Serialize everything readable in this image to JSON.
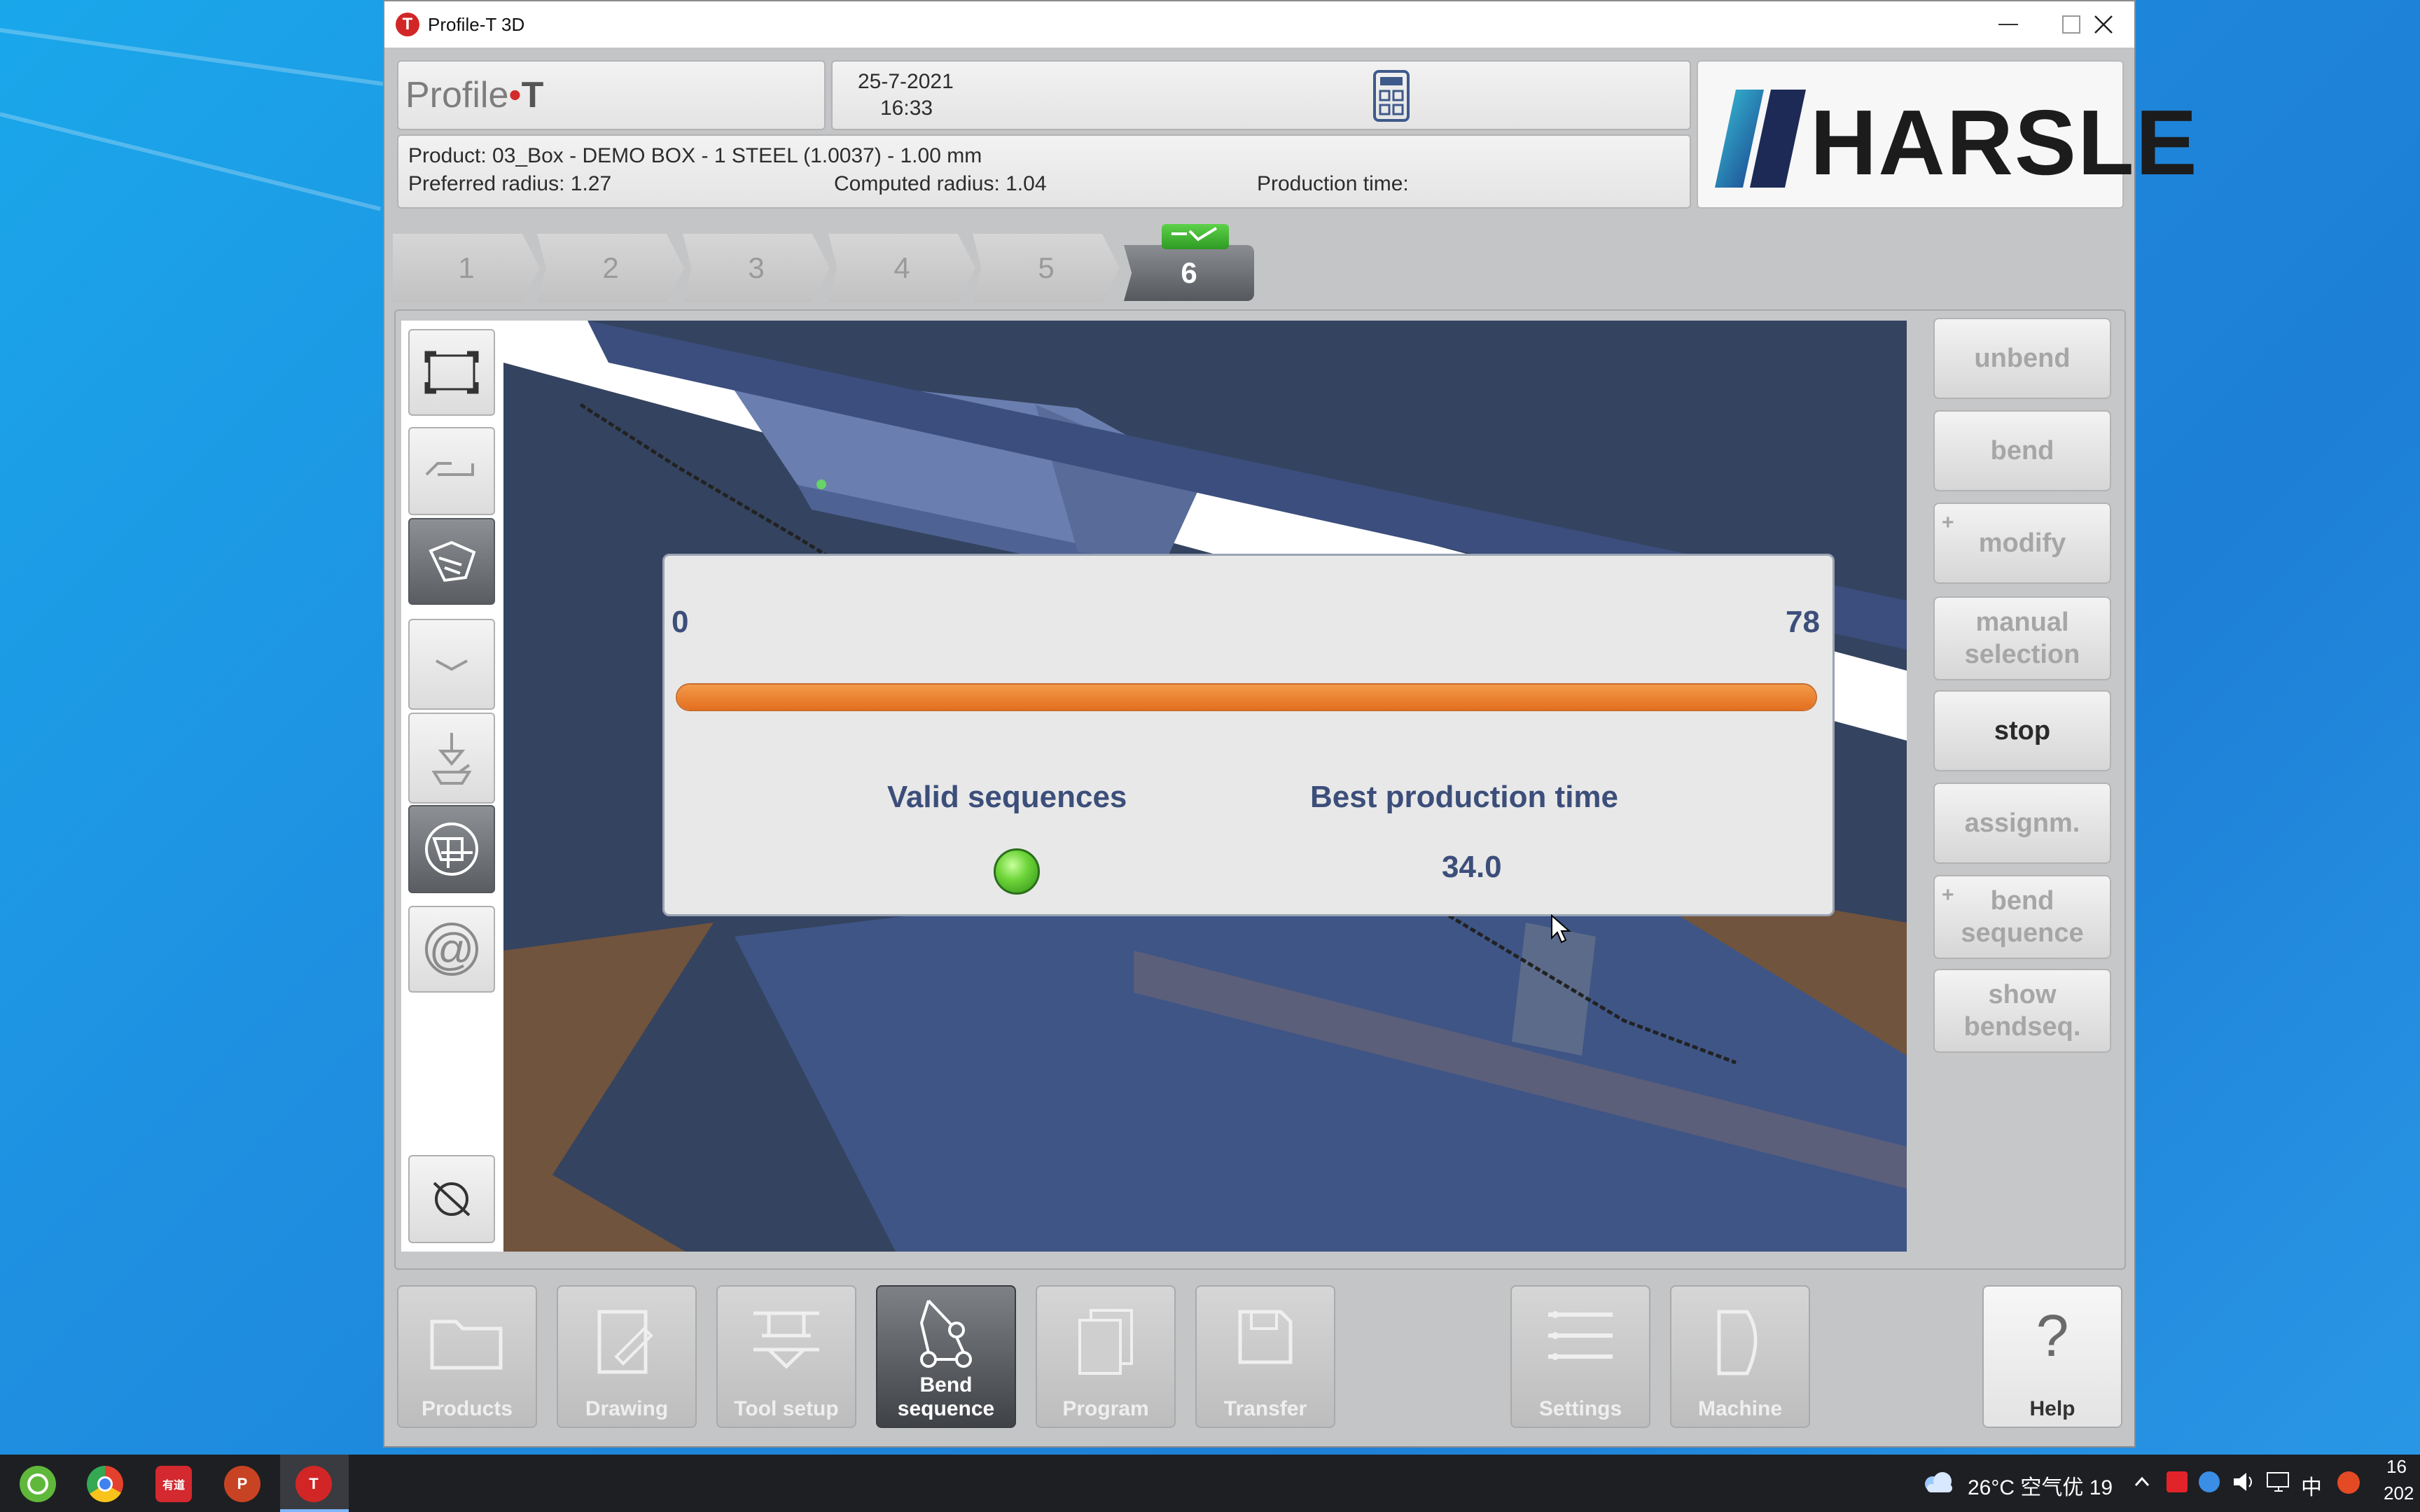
{
  "window": {
    "title": "Profile-T 3D"
  },
  "header": {
    "brand_prefix": "Profile",
    "brand_dot": "•",
    "brand_suffix": "T",
    "date": "25-7-2021",
    "time": "16:33",
    "logo_text": "HARSLE"
  },
  "product_info": {
    "product": "Product: 03_Box - DEMO BOX - 1 STEEL (1.0037) - 1.00 mm",
    "preferred_radius": "Preferred radius: 1.27",
    "computed_radius": "Computed radius: 1.04",
    "production_time": "Production time:"
  },
  "steps": [
    "1",
    "2",
    "3",
    "4",
    "5",
    "6"
  ],
  "active_step": "6",
  "dialog": {
    "min": "0",
    "max": "78",
    "progress_fraction": 1.0,
    "valid_sequences_label": "Valid sequences",
    "best_time_label": "Best production time",
    "best_time_value": "34.0",
    "status_color": "#5cc22f"
  },
  "actions": [
    {
      "label": "unbend",
      "enabled": false,
      "plus": false
    },
    {
      "label": "bend",
      "enabled": false,
      "plus": false
    },
    {
      "label": "modify",
      "enabled": false,
      "plus": true
    },
    {
      "label": "manual\nselection",
      "enabled": false,
      "plus": false
    },
    {
      "label": "stop",
      "enabled": true,
      "plus": false
    },
    {
      "label": "assignm.",
      "enabled": false,
      "plus": false
    },
    {
      "label": "bend\nsequence",
      "enabled": false,
      "plus": true
    },
    {
      "label": "show\nbendseq.",
      "enabled": false,
      "plus": false
    }
  ],
  "plus_symbol": "+",
  "left_tools": {
    "at_symbol": "@"
  },
  "nav": {
    "products": "Products",
    "drawing": "Drawing",
    "tool_setup": "Tool setup",
    "bend_sequence": "Bend\nsequence",
    "program": "Program",
    "transfer": "Transfer",
    "settings": "Settings",
    "machine": "Machine",
    "help": "Help",
    "help_glyph": "?"
  },
  "taskbar": {
    "weather": "26°C 空气优 19",
    "ime": "中",
    "clock_top": "16",
    "clock_bottom": "202",
    "icon_labels": {
      "note": "有道",
      "ppt": "P",
      "profile": "T"
    }
  },
  "colors": {
    "accent_orange": "#e87a2a",
    "dialog_text": "#3c4e7a",
    "brand_red": "#d22b2b"
  }
}
